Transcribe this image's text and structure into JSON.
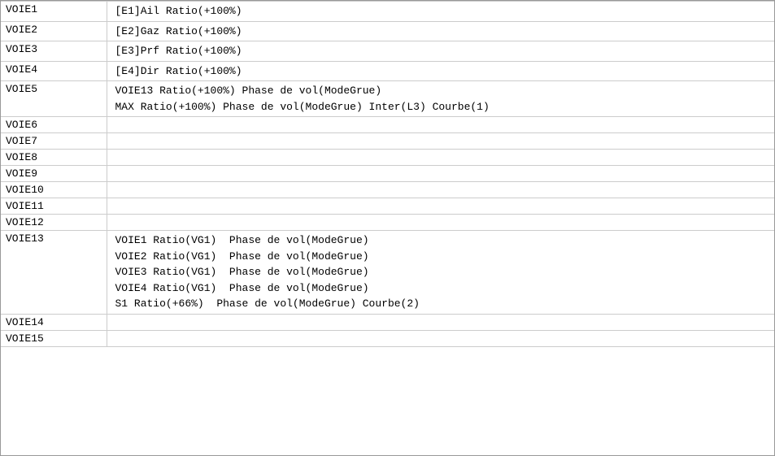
{
  "rows": [
    {
      "label": "VOIE1",
      "lines": [
        "[E1]Ail Ratio(+100%)"
      ]
    },
    {
      "label": "VOIE2",
      "lines": [
        "[E2]Gaz Ratio(+100%)"
      ]
    },
    {
      "label": "VOIE3",
      "lines": [
        "[E3]Prf Ratio(+100%)"
      ]
    },
    {
      "label": "VOIE4",
      "lines": [
        "[E4]Dir Ratio(+100%)"
      ]
    },
    {
      "label": "VOIE5",
      "lines": [
        "VOIE13 Ratio(+100%) Phase de vol(ModeGrue)",
        "MAX Ratio(+100%) Phase de vol(ModeGrue) Inter(L3) Courbe(1)"
      ]
    },
    {
      "label": "VOIE6",
      "lines": [
        ""
      ]
    },
    {
      "label": "VOIE7",
      "lines": [
        ""
      ]
    },
    {
      "label": "VOIE8",
      "lines": [
        ""
      ]
    },
    {
      "label": "VOIE9",
      "lines": [
        ""
      ]
    },
    {
      "label": "VOIE10",
      "lines": [
        ""
      ]
    },
    {
      "label": "VOIE11",
      "lines": [
        ""
      ]
    },
    {
      "label": "VOIE12",
      "lines": [
        ""
      ]
    },
    {
      "label": "VOIE13",
      "lines": [
        "VOIE1 Ratio(VG1)  Phase de vol(ModeGrue)",
        "VOIE2 Ratio(VG1)  Phase de vol(ModeGrue)",
        "VOIE3 Ratio(VG1)  Phase de vol(ModeGrue)",
        "VOIE4 Ratio(VG1)  Phase de vol(ModeGrue)",
        "S1 Ratio(+66%)  Phase de vol(ModeGrue) Courbe(2)"
      ]
    },
    {
      "label": "VOIE14",
      "lines": [
        ""
      ]
    },
    {
      "label": "VOIE15",
      "lines": [
        ""
      ]
    }
  ]
}
